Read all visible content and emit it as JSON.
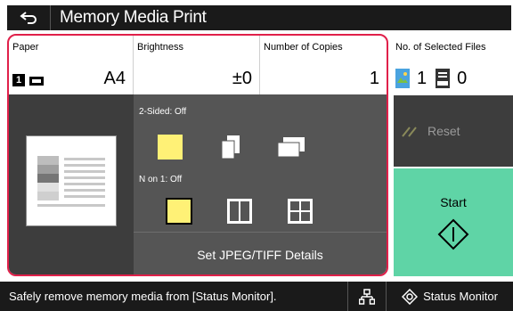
{
  "header": {
    "title": "Memory Media Print",
    "back_icon": "back-arrow-icon"
  },
  "settings": {
    "paper": {
      "label": "Paper",
      "drawer": "1",
      "value": "A4"
    },
    "brightness": {
      "label": "Brightness",
      "value": "±0"
    },
    "copies": {
      "label": "Number of Copies",
      "value": "1"
    }
  },
  "options": {
    "two_sided_label": "2-Sided: Off",
    "n_on_1_label": "N on 1: Off",
    "jpeg_button": "Set JPEG/TIFF Details"
  },
  "files": {
    "label": "No. of Selected Files",
    "jpeg_count": "1",
    "pdf_count": "0"
  },
  "actions": {
    "reset": "Reset",
    "start": "Start"
  },
  "status": {
    "message": "Safely remove memory media from [Status Monitor].",
    "status_monitor": "Status Monitor"
  },
  "colors": {
    "highlight": "#e0204a",
    "selected_yellow": "#fff176",
    "start_green": "#5fd4a6"
  }
}
